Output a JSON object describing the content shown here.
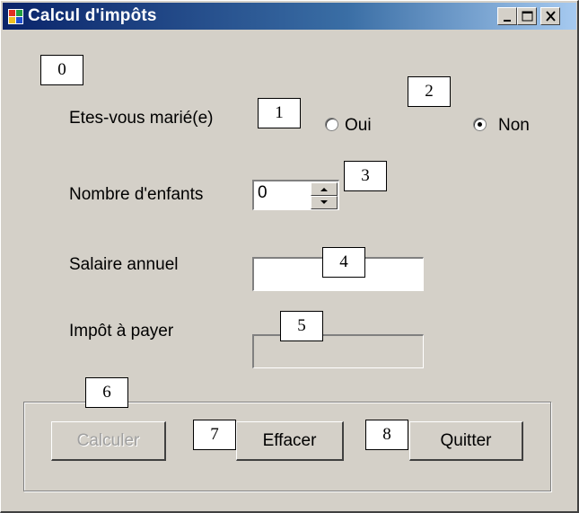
{
  "window": {
    "title": "Calcul d'impôts",
    "controls": [
      "minimize",
      "maximize",
      "close"
    ]
  },
  "labels": {
    "married": "Etes-vous marié(e)",
    "children": "Nombre d'enfants",
    "salary": "Salaire annuel",
    "tax": "Impôt à payer"
  },
  "radios": {
    "yes": {
      "label": "Oui",
      "selected": false
    },
    "no": {
      "label": "Non",
      "selected": true
    }
  },
  "children_spinner": {
    "value": "0"
  },
  "salary_input": {
    "value": ""
  },
  "tax_output": {
    "value": ""
  },
  "buttons": {
    "calculate": {
      "label": "Calculer",
      "enabled": false
    },
    "clear": {
      "label": "Effacer",
      "enabled": true
    },
    "quit": {
      "label": "Quitter",
      "enabled": true
    }
  },
  "callouts": [
    "0",
    "1",
    "2",
    "3",
    "4",
    "5",
    "6",
    "7",
    "8"
  ],
  "colors": {
    "face": "#d4d0c8",
    "title_start": "#0a246a",
    "title_end": "#a6caf0"
  }
}
